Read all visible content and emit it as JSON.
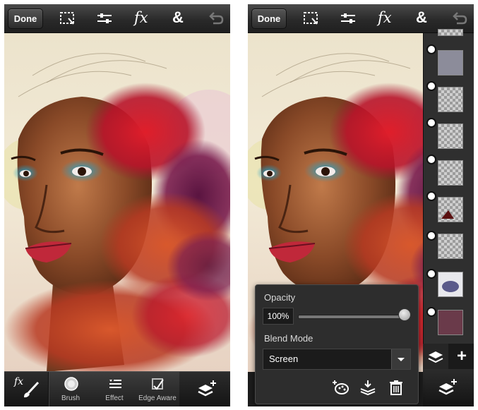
{
  "screens": [
    {
      "toolbar": {
        "done_label": "Done",
        "fx_label": "fx",
        "amp_label": "&",
        "icons": [
          "selection-icon",
          "adjustments-icon",
          "fx-icon",
          "ampersand-icon",
          "undo-icon"
        ]
      },
      "bottom_toolbar": {
        "fx_label": "fx",
        "items": [
          {
            "label": "Brush",
            "icon": "brush-icon"
          },
          {
            "label": "Effect",
            "icon": "effect-list-icon"
          },
          {
            "label": "Edge Aware",
            "icon": "edge-aware-icon"
          }
        ]
      }
    },
    {
      "toolbar": {
        "done_label": "Done",
        "fx_label": "fx",
        "amp_label": "&",
        "icons": [
          "selection-icon",
          "adjustments-icon",
          "fx-icon",
          "ampersand-icon",
          "undo-icon"
        ]
      },
      "layer_panel": {
        "plus_label": "+",
        "layer_count": 8
      },
      "popover": {
        "opacity_label": "Opacity",
        "opacity_value": "100%",
        "opacity_fraction": 1.0,
        "blend_mode_label": "Blend Mode",
        "blend_mode_value": "Screen",
        "actions": [
          "layer-properties-icon",
          "merge-down-icon",
          "trash-icon"
        ]
      }
    }
  ],
  "colors": {
    "toolbar_top": "#4a4a4a",
    "toolbar_bottom": "#1f1f1f",
    "panel_bg": "#2d2d2d"
  }
}
